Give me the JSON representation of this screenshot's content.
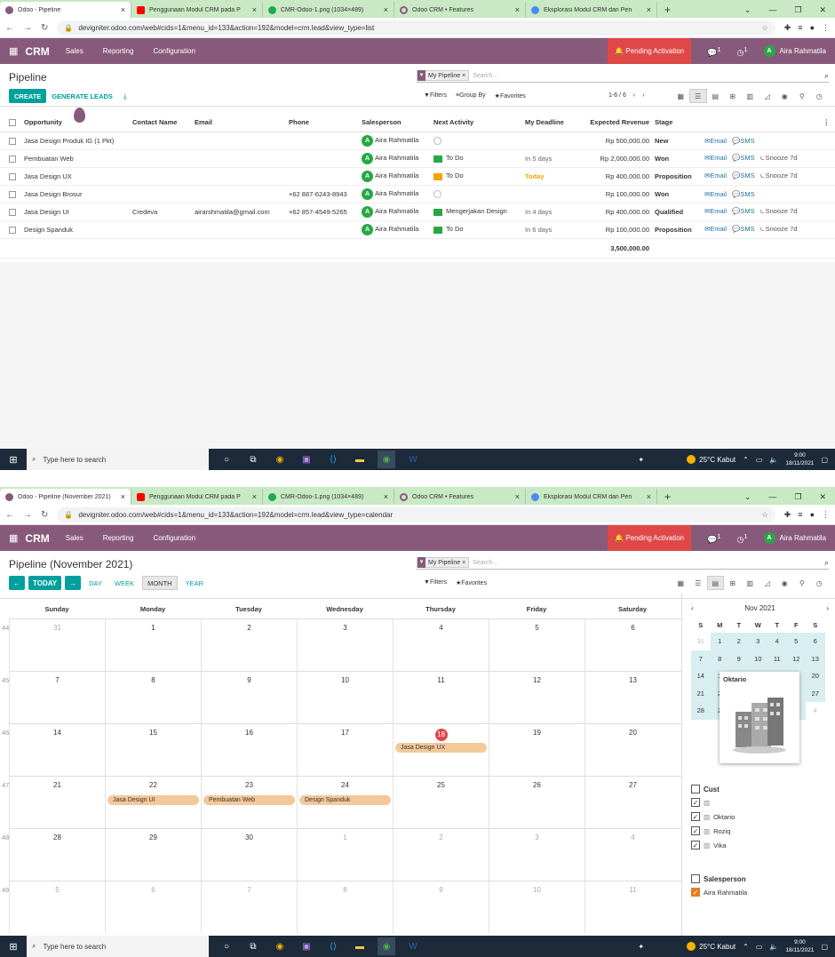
{
  "browser": {
    "tabs": [
      {
        "title": "Odoo - Pipeline",
        "color": "#875a7b"
      },
      {
        "title": "Penggunaan Modul CRM pada P",
        "color": "#ff0000"
      },
      {
        "title": "CMR-Odoo-1.png (1034×489)",
        "color": "#1faa4f"
      },
      {
        "title": "Odoo CRM • Features",
        "color": "#875a7b"
      },
      {
        "title": "Eksplorasi Modul CRM dan Pen",
        "color": "#4c8bf5"
      }
    ],
    "tabs2_first": "Odoo - Pipeline (November 2021)",
    "url_list": "devigniter.odoo.com/web#cids=1&menu_id=133&action=192&model=crm.lead&view_type=list",
    "url_calendar": "devigniter.odoo.com/web#cids=1&menu_id=133&action=192&model=crm.lead&view_type=calendar"
  },
  "odoo": {
    "app": "CRM",
    "menus": [
      "Sales",
      "Reporting",
      "Configuration"
    ],
    "pending": "Pending Activation",
    "user": "Aira Rahmatila",
    "avatar": "A",
    "msg_count": "1",
    "act_count": "1"
  },
  "list_view": {
    "title": "Pipeline",
    "facet": "My Pipeline",
    "search_placeholder": "Search...",
    "create": "CREATE",
    "generate": "GENERATE LEADS",
    "filters": "Filters",
    "group_by": "Group By",
    "favorites": "Favorites",
    "pager": "1-6 / 6",
    "columns": [
      "Opportunity",
      "Contact Name",
      "Email",
      "Phone",
      "Salesperson",
      "Next Activity",
      "My Deadline",
      "Expected Revenue",
      "Stage"
    ],
    "rows": [
      {
        "opportunity": "Jasa Design Produk IG (1 Pkt)",
        "contact": "",
        "email": "",
        "phone": "",
        "salesperson": "Aira Rahmatila",
        "activity": "",
        "deadline": "",
        "revenue": "Rp 500,000.00",
        "stage": "New",
        "snooze": false
      },
      {
        "opportunity": "Pembuatan Web",
        "contact": "",
        "email": "",
        "phone": "",
        "salesperson": "Aira Rahmatila",
        "activity": "To Do",
        "deadline": "In 5 days",
        "revenue": "Rp 2,000,000.00",
        "stage": "Won",
        "snooze": true
      },
      {
        "opportunity": "Jasa Design UX",
        "contact": "",
        "email": "",
        "phone": "",
        "salesperson": "Aira Rahmatila",
        "activity": "To Do",
        "deadline": "Today",
        "revenue": "Rp 400,000.00",
        "stage": "Proposition",
        "snooze": true
      },
      {
        "opportunity": "Jasa Design Brosur",
        "contact": "",
        "email": "",
        "phone": "+62 887-6243-8943",
        "salesperson": "Aira Rahmatila",
        "activity": "",
        "deadline": "",
        "revenue": "Rp 100,000.00",
        "stage": "Won",
        "snooze": false
      },
      {
        "opportunity": "Jasa Design UI",
        "contact": "Credeva",
        "email": "airarshmatila@gmail.com",
        "phone": "+62 857-4549-5265",
        "salesperson": "Aira Rahmatila",
        "activity": "Mengerjakan Design",
        "deadline": "In 4 days",
        "revenue": "Rp 400,000.00",
        "stage": "Qualified",
        "snooze": true
      },
      {
        "opportunity": "Design Spanduk",
        "contact": "",
        "email": "",
        "phone": "",
        "salesperson": "Aira Rahmatila",
        "activity": "To Do",
        "deadline": "In 6 days",
        "revenue": "Rp 100,000.00",
        "stage": "Proposition",
        "snooze": true
      }
    ],
    "total": "3,500,000.00",
    "act_email": "Email",
    "act_sms": "SMS",
    "act_snooze": "Snooze 7d"
  },
  "calendar_view": {
    "title": "Pipeline (November 2021)",
    "today": "TODAY",
    "scales": [
      "DAY",
      "WEEK",
      "MONTH",
      "YEAR"
    ],
    "weekdays": [
      "Sunday",
      "Monday",
      "Tuesday",
      "Wednesday",
      "Thursday",
      "Friday",
      "Saturday"
    ],
    "weeks": [
      {
        "num": "44",
        "days": [
          "31",
          "1",
          "2",
          "3",
          "4",
          "5",
          "6"
        ]
      },
      {
        "num": "45",
        "days": [
          "7",
          "8",
          "9",
          "10",
          "11",
          "12",
          "13"
        ]
      },
      {
        "num": "46",
        "days": [
          "14",
          "15",
          "16",
          "17",
          "18",
          "19",
          "20"
        ]
      },
      {
        "num": "47",
        "days": [
          "21",
          "22",
          "23",
          "24",
          "25",
          "26",
          "27"
        ]
      },
      {
        "num": "48",
        "days": [
          "28",
          "29",
          "30",
          "1",
          "2",
          "3",
          "4"
        ]
      },
      {
        "num": "49",
        "days": [
          "5",
          "6",
          "7",
          "8",
          "9",
          "10",
          "11"
        ]
      }
    ],
    "events": {
      "uxe": "Jasa Design UX",
      "uie": "Jasa Design UI",
      "webe": "Pembuatan Web",
      "spe": "Design Spanduk"
    },
    "mini": {
      "month": "Nov 2021",
      "dow": [
        "S",
        "M",
        "T",
        "W",
        "T",
        "F",
        "S"
      ],
      "rows": [
        [
          "31",
          "1",
          "2",
          "3",
          "4",
          "5",
          "6"
        ],
        [
          "7",
          "8",
          "9",
          "10",
          "11",
          "12",
          "13"
        ],
        [
          "14",
          "1",
          "",
          "",
          "",
          "9",
          "20"
        ],
        [
          "21",
          "2",
          "",
          "",
          "",
          "5",
          "27"
        ],
        [
          "28",
          "2",
          "",
          "",
          "",
          "",
          "4"
        ]
      ]
    },
    "tooltip_name": "Oktario",
    "customer_filter": "Cust",
    "customers": [
      "",
      "Oktario",
      "Roziq",
      "Vika"
    ],
    "salesperson_filter": "Salesperson",
    "salesperson": "Aira Rahmatila"
  },
  "taskbar": {
    "search": "Type here to search",
    "weather": "25°C  Kabut",
    "time": "9:00",
    "date": "18/11/2021"
  }
}
